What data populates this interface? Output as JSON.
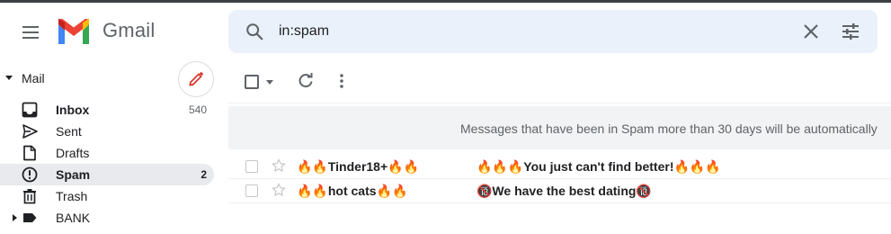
{
  "app": {
    "name": "Gmail",
    "brand_colors": {
      "red": "#ea4335",
      "blue": "#4285f4",
      "green": "#34a853",
      "yellow": "#fbbc04"
    }
  },
  "header": {
    "menu_icon": "hamburger-menu-icon",
    "search": {
      "value": "in:spam",
      "icons": [
        "search-icon",
        "close-icon",
        "tune-icon"
      ],
      "background": "#eaf1fb"
    }
  },
  "sidebar": {
    "section_label": "Mail",
    "compose_icon": "pencil-icon",
    "items": [
      {
        "label": "Inbox",
        "count": "540",
        "icon": "inbox-icon",
        "bold": true
      },
      {
        "label": "Sent",
        "count": "",
        "icon": "send-icon",
        "bold": false
      },
      {
        "label": "Drafts",
        "count": "",
        "icon": "draft-icon",
        "bold": false
      },
      {
        "label": "Spam",
        "count": "2",
        "icon": "spam-icon",
        "bold": true,
        "active": true
      },
      {
        "label": "Trash",
        "count": "",
        "icon": "trash-icon",
        "bold": false
      },
      {
        "label": "BANK",
        "count": "",
        "icon": "label-icon",
        "bold": false
      }
    ],
    "active_bg": "#e8eaed"
  },
  "toolbar": {
    "icons": [
      "checkbox-icon",
      "chevron-down-icon",
      "refresh-icon",
      "more-vertical-icon"
    ]
  },
  "banner": {
    "text": "Messages that have been in Spam more than 30 days will be automatically"
  },
  "emails": [
    {
      "sender": "🔥🔥Tinder18+🔥🔥",
      "subject": "🔥🔥🔥You just can't find better!🔥🔥🔥"
    },
    {
      "sender": "🔥🔥hot cats🔥🔥",
      "subject": "🔞We have the best dating🔞"
    }
  ]
}
